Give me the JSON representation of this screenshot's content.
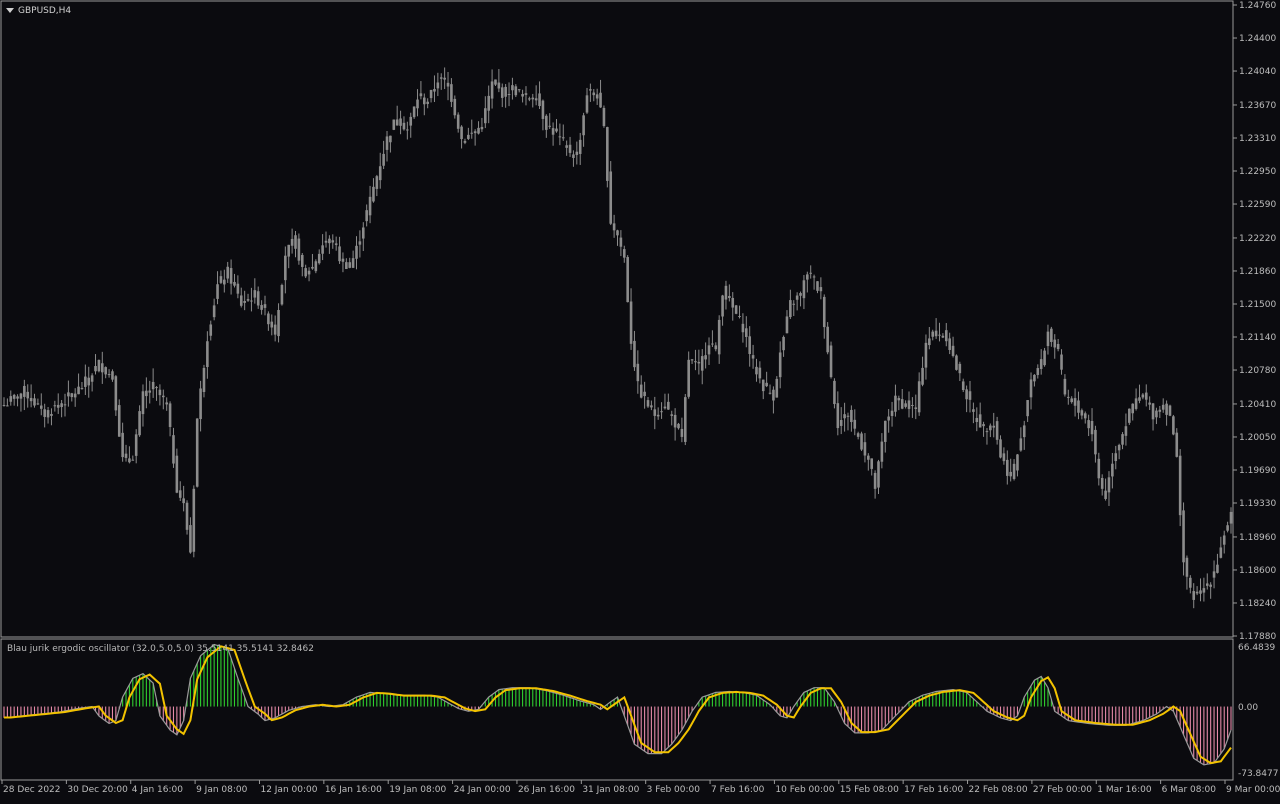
{
  "window": {
    "symbol_label": "GBPUSD,H4",
    "dropdown_icon": "triangle-down-icon"
  },
  "indicator": {
    "label": "Blau jurik ergodic oscillator (32.0,5.0,5.0) 35.5141 35.5141 32.8462",
    "scale_top": "66.4839",
    "scale_zero": "0.00",
    "scale_bottom": "-73.8477"
  },
  "colors": {
    "background": "#0b0b0f",
    "frame": "#9a9a9a",
    "candle": "#8c8c8c",
    "histogram_positive": "#2fcf2f",
    "histogram_negative": "#e68aa8",
    "signal_line": "#f2c200",
    "main_line": "#9a9a9a"
  },
  "chart_data": [
    {
      "type": "candlestick",
      "title": "GBPUSD,H4",
      "ylim": [
        1.1788,
        1.2476
      ],
      "y_ticks": [
        "1.24760",
        "1.24400",
        "1.24040",
        "1.23670",
        "1.23310",
        "1.22950",
        "1.22590",
        "1.22220",
        "1.21860",
        "1.21500",
        "1.21140",
        "1.20780",
        "1.20410",
        "1.20050",
        "1.19690",
        "1.19330",
        "1.18960",
        "1.18600",
        "1.18240",
        "1.17880"
      ],
      "x_ticks": [
        "28 Dec 2022",
        "30 Dec 20:00",
        "4 Jan 16:00",
        "9 Jan 08:00",
        "12 Jan 00:00",
        "16 Jan 16:00",
        "19 Jan 08:00",
        "24 Jan 00:00",
        "26 Jan 16:00",
        "31 Jan 08:00",
        "3 Feb 00:00",
        "7 Feb 16:00",
        "10 Feb 00:00",
        "15 Feb 08:00",
        "17 Feb 16:00",
        "22 Feb 08:00",
        "27 Feb 00:00",
        "1 Mar 16:00",
        "6 Mar 08:00",
        "9 Mar 00:00"
      ],
      "close_path": [
        [
          0,
          1.204
        ],
        [
          6,
          1.2055
        ],
        [
          12,
          1.203
        ],
        [
          18,
          1.2045
        ],
        [
          23,
          1.206
        ],
        [
          28,
          1.2085
        ],
        [
          32,
          1.207
        ],
        [
          35,
          1.198
        ],
        [
          38,
          1.1985
        ],
        [
          41,
          1.205
        ],
        [
          44,
          1.206
        ],
        [
          48,
          1.204
        ],
        [
          51,
          1.195
        ],
        [
          53,
          1.193
        ],
        [
          55,
          1.188
        ],
        [
          57,
          1.2025
        ],
        [
          60,
          1.2115
        ],
        [
          63,
          1.217
        ],
        [
          66,
          1.2185
        ],
        [
          70,
          1.215
        ],
        [
          74,
          1.216
        ],
        [
          77,
          1.214
        ],
        [
          80,
          1.212
        ],
        [
          83,
          1.2205
        ],
        [
          86,
          1.222
        ],
        [
          88,
          1.2185
        ],
        [
          91,
          1.219
        ],
        [
          94,
          1.2215
        ],
        [
          97,
          1.222
        ],
        [
          99,
          1.22
        ],
        [
          102,
          1.219
        ],
        [
          104,
          1.221
        ],
        [
          107,
          1.225
        ],
        [
          110,
          1.229
        ],
        [
          113,
          1.233
        ],
        [
          116,
          1.2355
        ],
        [
          119,
          1.234
        ],
        [
          122,
          1.2375
        ],
        [
          125,
          1.237
        ],
        [
          128,
          1.2395
        ],
        [
          131,
          1.239
        ],
        [
          133,
          1.236
        ],
        [
          135,
          1.233
        ],
        [
          138,
          1.2335
        ],
        [
          141,
          1.2345
        ],
        [
          144,
          1.239
        ],
        [
          147,
          1.238
        ],
        [
          150,
          1.2385
        ],
        [
          154,
          1.2375
        ],
        [
          157,
          1.2378
        ],
        [
          160,
          1.2345
        ],
        [
          163,
          1.2335
        ],
        [
          166,
          1.232
        ],
        [
          169,
          1.231
        ],
        [
          172,
          1.238
        ],
        [
          175,
          1.2378
        ],
        [
          177,
          1.234
        ],
        [
          179,
          1.224
        ],
        [
          181,
          1.2225
        ],
        [
          183,
          1.22
        ],
        [
          185,
          1.211
        ],
        [
          187,
          1.206
        ],
        [
          189,
          1.2045
        ],
        [
          192,
          1.203
        ],
        [
          195,
          1.204
        ],
        [
          198,
          1.202
        ],
        [
          200,
          1.2
        ],
        [
          202,
          1.209
        ],
        [
          205,
          1.208
        ],
        [
          208,
          1.211
        ],
        [
          210,
          1.21
        ],
        [
          212,
          1.2165
        ],
        [
          215,
          1.2145
        ],
        [
          218,
          1.2125
        ],
        [
          221,
          1.2085
        ],
        [
          224,
          1.206
        ],
        [
          227,
          1.205
        ],
        [
          229,
          1.2095
        ],
        [
          232,
          1.215
        ],
        [
          235,
          1.216
        ],
        [
          237,
          1.2185
        ],
        [
          239,
          1.2175
        ],
        [
          241,
          1.216
        ],
        [
          244,
          1.207
        ],
        [
          246,
          1.202
        ],
        [
          249,
          1.203
        ],
        [
          252,
          1.2005
        ],
        [
          255,
          1.198
        ],
        [
          257,
          1.195
        ],
        [
          260,
          1.202
        ],
        [
          263,
          1.2045
        ],
        [
          266,
          1.204
        ],
        [
          269,
          1.2035
        ],
        [
          272,
          1.211
        ],
        [
          275,
          1.212
        ],
        [
          278,
          1.2115
        ],
        [
          281,
          1.208
        ],
        [
          284,
          1.205
        ],
        [
          286,
          1.203
        ],
        [
          289,
          1.2015
        ],
        [
          292,
          1.202
        ],
        [
          294,
          1.1985
        ],
        [
          297,
          1.196
        ],
        [
          300,
          1.2
        ],
        [
          303,
          1.207
        ],
        [
          306,
          1.2085
        ],
        [
          308,
          1.212
        ],
        [
          311,
          1.2095
        ],
        [
          313,
          1.205
        ],
        [
          316,
          1.204
        ],
        [
          319,
          1.2025
        ],
        [
          321,
          1.201
        ],
        [
          323,
          1.196
        ],
        [
          325,
          1.194
        ],
        [
          327,
          1.198
        ],
        [
          330,
          1.201
        ],
        [
          333,
          1.204
        ],
        [
          336,
          1.205
        ],
        [
          339,
          1.203
        ],
        [
          342,
          1.204
        ],
        [
          344,
          1.203
        ],
        [
          346,
          1.198
        ],
        [
          348,
          1.187
        ],
        [
          350,
          1.1835
        ],
        [
          352,
          1.183
        ],
        [
          354,
          1.184
        ],
        [
          356,
          1.185
        ],
        [
          358,
          1.187
        ],
        [
          360,
          1.19
        ],
        [
          362,
          1.192
        ]
      ]
    },
    {
      "type": "bar",
      "title": "Blau jurik ergodic oscillator (32.0,5.0,5.0)",
      "ylim": [
        -73.8477,
        66.4839
      ],
      "last_values": [
        35.5141,
        35.5141,
        32.8462
      ],
      "series_path": [
        [
          0,
          -12
        ],
        [
          8,
          -9
        ],
        [
          16,
          -6
        ],
        [
          22,
          -2
        ],
        [
          26,
          0
        ],
        [
          28,
          -10
        ],
        [
          31,
          -18
        ],
        [
          33,
          -15
        ],
        [
          35,
          10
        ],
        [
          38,
          30
        ],
        [
          41,
          35
        ],
        [
          44,
          25
        ],
        [
          46,
          -10
        ],
        [
          49,
          -25
        ],
        [
          51,
          -30
        ],
        [
          53,
          -15
        ],
        [
          55,
          30
        ],
        [
          58,
          54
        ],
        [
          62,
          66
        ],
        [
          66,
          62
        ],
        [
          69,
          30
        ],
        [
          72,
          0
        ],
        [
          75,
          -8
        ],
        [
          77,
          -15
        ],
        [
          80,
          -12
        ],
        [
          84,
          -4
        ],
        [
          88,
          0
        ],
        [
          92,
          2
        ],
        [
          96,
          0
        ],
        [
          100,
          2
        ],
        [
          104,
          10
        ],
        [
          108,
          15
        ],
        [
          112,
          14
        ],
        [
          116,
          12
        ],
        [
          120,
          12
        ],
        [
          124,
          12
        ],
        [
          128,
          10
        ],
        [
          131,
          4
        ],
        [
          134,
          -2
        ],
        [
          137,
          -5
        ],
        [
          140,
          -3
        ],
        [
          143,
          10
        ],
        [
          146,
          18
        ],
        [
          150,
          20
        ],
        [
          155,
          20
        ],
        [
          160,
          17
        ],
        [
          165,
          12
        ],
        [
          170,
          6
        ],
        [
          174,
          2
        ],
        [
          176,
          -3
        ],
        [
          179,
          5
        ],
        [
          181,
          10
        ],
        [
          183,
          -10
        ],
        [
          186,
          -40
        ],
        [
          190,
          -50
        ],
        [
          194,
          -50
        ],
        [
          197,
          -40
        ],
        [
          200,
          -25
        ],
        [
          203,
          -5
        ],
        [
          206,
          10
        ],
        [
          210,
          15
        ],
        [
          214,
          16
        ],
        [
          218,
          15
        ],
        [
          222,
          12
        ],
        [
          226,
          2
        ],
        [
          229,
          -10
        ],
        [
          231,
          -12
        ],
        [
          233,
          0
        ],
        [
          236,
          15
        ],
        [
          239,
          20
        ],
        [
          242,
          20
        ],
        [
          245,
          5
        ],
        [
          248,
          -18
        ],
        [
          251,
          -28
        ],
        [
          255,
          -28
        ],
        [
          259,
          -25
        ],
        [
          263,
          -10
        ],
        [
          267,
          5
        ],
        [
          271,
          12
        ],
        [
          275,
          16
        ],
        [
          280,
          18
        ],
        [
          284,
          15
        ],
        [
          287,
          5
        ],
        [
          290,
          -5
        ],
        [
          294,
          -12
        ],
        [
          297,
          -15
        ],
        [
          299,
          -10
        ],
        [
          301,
          10
        ],
        [
          304,
          28
        ],
        [
          306,
          32
        ],
        [
          308,
          20
        ],
        [
          310,
          -5
        ],
        [
          314,
          -15
        ],
        [
          320,
          -18
        ],
        [
          326,
          -20
        ],
        [
          331,
          -20
        ],
        [
          336,
          -15
        ],
        [
          340,
          -8
        ],
        [
          343,
          0
        ],
        [
          345,
          -5
        ],
        [
          348,
          -30
        ],
        [
          351,
          -55
        ],
        [
          354,
          -62
        ],
        [
          357,
          -60
        ],
        [
          360,
          -45
        ],
        [
          362,
          -25
        ]
      ]
    }
  ]
}
